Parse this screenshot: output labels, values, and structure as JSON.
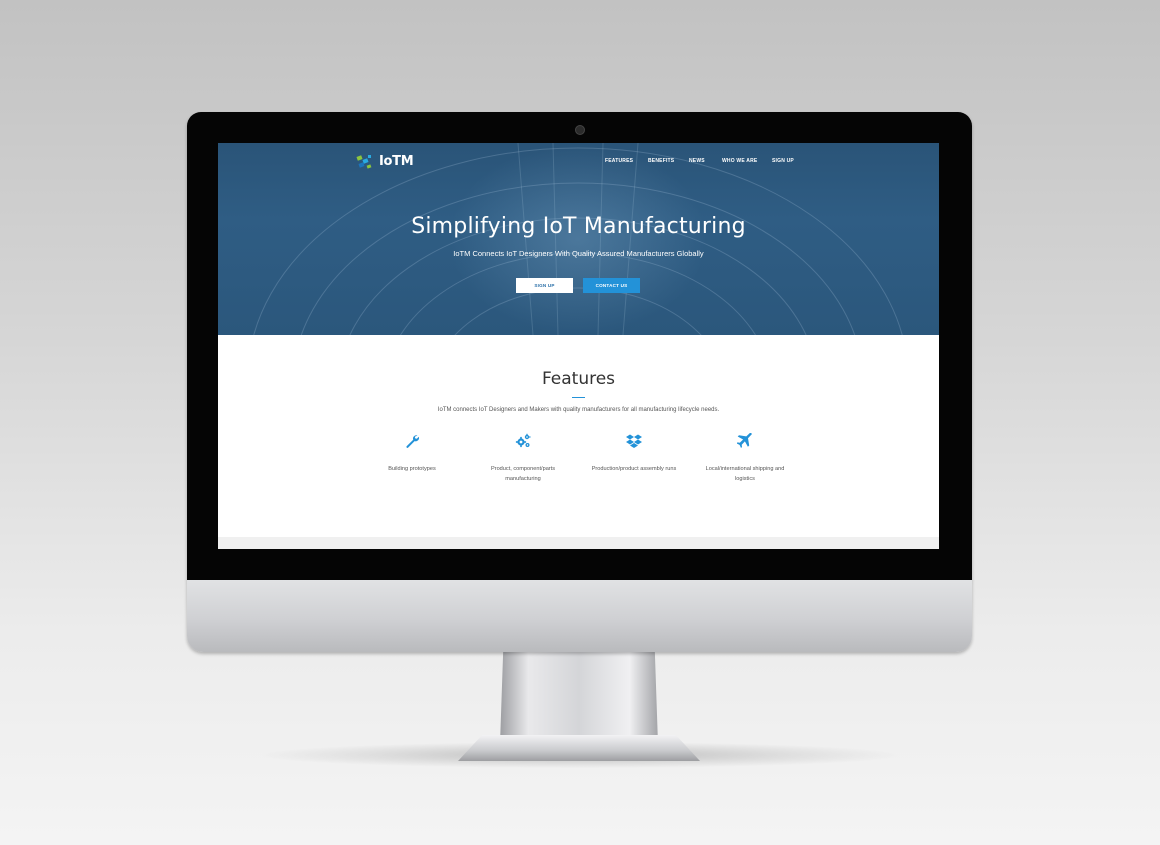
{
  "brand": {
    "logo_text": "IoTM",
    "logo_colors": [
      "#8cc63f",
      "#29abe2",
      "#1c75bc"
    ]
  },
  "nav": {
    "items": [
      {
        "label": "FEATURES"
      },
      {
        "label": "BENEFITS"
      },
      {
        "label": "NEWS"
      },
      {
        "label": "WHO WE ARE"
      },
      {
        "label": "SIGN UP"
      }
    ]
  },
  "hero": {
    "title": "Simplifying IoT Manufacturing",
    "subtitle": "IoTM Connects IoT Designers With Quality Assured Manufacturers Globally",
    "signup_label": "SIGN UP",
    "contact_label": "CONTACT US"
  },
  "features": {
    "title": "Features",
    "description": "IoTM connects IoT Designers and Makers with quality manufacturers for all manufacturing lifecycle needs.",
    "items": [
      {
        "icon": "wrench-icon",
        "label": "Building prototypes"
      },
      {
        "icon": "gears-icon",
        "label": "Product, component/parts manufacturing"
      },
      {
        "icon": "boxes-icon",
        "label": "Production/product assembly runs"
      },
      {
        "icon": "airplane-icon",
        "label": "Local/international shipping and logistics"
      }
    ]
  },
  "colors": {
    "hero_bg": "#2c5880",
    "accent": "#2392d8",
    "text": "#333333"
  }
}
